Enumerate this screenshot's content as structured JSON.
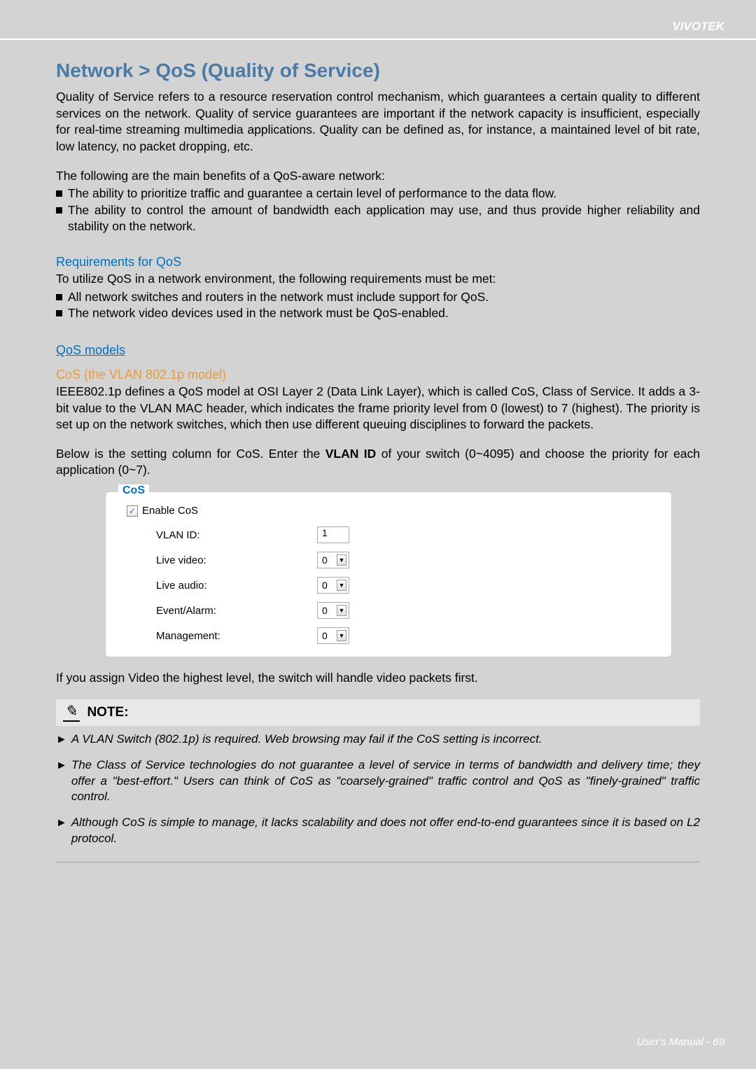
{
  "brand": "VIVOTEK",
  "footer": "User's Manual - 69",
  "title": "Network > QoS (Quality of Service)",
  "intro": "Quality of Service refers to a resource reservation control mechanism, which guarantees a certain quality to different services on the network. Quality of service guarantees are important if the network capacity is insufficient, especially for real-time streaming multimedia applications. Quality can be defined as, for instance, a maintained level of bit rate, low latency, no packet dropping, etc.",
  "benefits_lead": "The following are the main benefits of a QoS-aware network:",
  "benefits": [
    "The ability to prioritize traffic and guarantee a certain level of performance to the data flow.",
    "The ability to control the amount of bandwidth each application may use, and thus provide higher reliability and stability on the network."
  ],
  "req_heading": "Requirements for QoS",
  "req_lead": "To utilize QoS in a network environment, the following requirements must be met:",
  "req_items": [
    "All network switches and routers in the network must include support for QoS.",
    "The network video devices used in the network must be QoS-enabled."
  ],
  "models_heading": "QoS models",
  "cos_heading": "CoS (the VLAN 802.1p model)",
  "cos_para": "IEEE802.1p defines a QoS model at OSI Layer 2 (Data Link Layer), which is called CoS, Class of Service. It adds a 3-bit value to the VLAN MAC header, which indicates the frame priority level from 0 (lowest) to 7 (highest). The priority is set up on the network switches, which then use different queuing disciplines to forward the packets.",
  "cos_below_pre": "Below is the setting column for CoS. Enter the ",
  "cos_below_bold": "VLAN ID",
  "cos_below_post": " of your switch (0~4095) and choose the priority for each application (0~7).",
  "cos_box": {
    "legend": "CoS",
    "enable_label": "Enable CoS",
    "checked": "✓",
    "rows": {
      "vlan_label": "VLAN ID:",
      "vlan_value": "1",
      "live_video_label": "Live video:",
      "live_video_value": "0",
      "live_audio_label": "Live audio:",
      "live_audio_value": "0",
      "event_label": "Event/Alarm:",
      "event_value": "0",
      "mgmt_label": "Management:",
      "mgmt_value": "0"
    }
  },
  "after_box": "If you assign Video the highest level, the switch will handle video packets first.",
  "note_label": "NOTE:",
  "notes": [
    "A VLAN Switch (802.1p) is required. Web browsing may fail if the CoS setting is incorrect.",
    "The Class of Service technologies do not guarantee a level of service in terms of bandwidth and delivery time; they offer a \"best-effort.\" Users can think of CoS as \"coarsely-grained\" traffic control and QoS as \"finely-grained\" traffic control.",
    "Although CoS is simple to manage, it lacks scalability and does not offer end-to-end guarantees since it is based on L2 protocol."
  ]
}
